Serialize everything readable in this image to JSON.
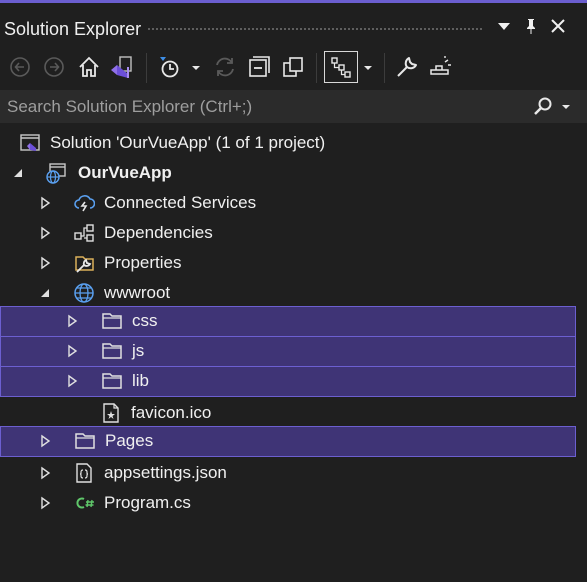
{
  "window": {
    "title": "Solution Explorer"
  },
  "search": {
    "placeholder": "Search Solution Explorer (Ctrl+;)"
  },
  "tree": {
    "solution": "Solution 'OurVueApp' (1 of 1 project)",
    "project": "OurVueApp",
    "items": [
      {
        "label": "Connected Services",
        "icon": "connected-services-icon"
      },
      {
        "label": "Dependencies",
        "icon": "dependencies-icon"
      },
      {
        "label": "Properties",
        "icon": "properties-wrench-icon"
      },
      {
        "label": "wwwroot",
        "icon": "globe-icon"
      },
      {
        "label": "css",
        "icon": "folder-icon"
      },
      {
        "label": "js",
        "icon": "folder-icon"
      },
      {
        "label": "lib",
        "icon": "folder-icon"
      },
      {
        "label": "favicon.ico",
        "icon": "icon-file-icon"
      },
      {
        "label": "Pages",
        "icon": "folder-icon"
      },
      {
        "label": "appsettings.json",
        "icon": "json-file-icon"
      },
      {
        "label": "Program.cs",
        "icon": "csharp-file-icon"
      }
    ]
  },
  "colors": {
    "selection": "#3f3476",
    "selection_border": "#6c5fd0",
    "accent": "#6b5ecf",
    "background": "#1f1f1f"
  }
}
